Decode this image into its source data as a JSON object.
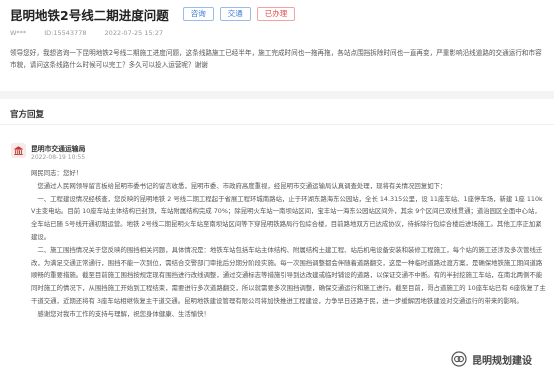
{
  "header": {
    "title": "昆明地铁2号线二期进度问题",
    "tags": [
      "咨询",
      "交通",
      "已办理"
    ],
    "user": "W***",
    "id": "ID:15543778",
    "date": "2022-07-25 15:27"
  },
  "question": "领导您好，我想咨询一下昆明地铁2号线二期施工进度问题，这条线路施工已经半年，施工完成时间也一拖再拖，各站点围挡拆除时间也一直再变，严重影响沿线道路的交通运行和市容市貌，请问这条线路什么时候可以完工？多久可以投入运营呢？谢谢",
  "section_title": "官方回复",
  "reply": {
    "org": "昆明市交通运输局",
    "date": "2022-08-19 10:55",
    "paragraphs": [
      "网民同志：您好！",
      "您通过人民网领导留言板给昆明市委书记的留言收悉，昆明市委、市政府高度重视，经昆明市交通运输局认真调查处理，现将有关情况回复如下：",
      "一、工程建设情况经核查，您反映的昆明地铁 2 号线二期工程起于省展工程环城南路站，止于环湖东路海东公园站，全长 14.315公里，设 11座车站、1座停车场，新建 1座 110kV主变电站。目前 10座车站主体结构已封顶，车站附属结构完成 70%；除昆明火车站一南坝站区间，宝丰站一海东公园站区间外，其余 9个区间已双线贯通；道治园区全面中心站，全车站已随 5号线开通初期运营。地铁 2号线二期昆明火车站至南坝站区间等下穿昆明铁路局行包綜合楼，目前路地双方已达成协议，待拆除行包綜合楼后进场施工。其他工序正加紧建设。",
      "二、施工围挡情况关于您反映的围挡相关问题，具体情况是：地铁车站包括车站主体结构、附属结构土建工程、站后机电设备安装和装修工程施工，每个站的施工还涉及多次管线迁改，为满足交通正常通行，围挡不能一次到位，需结合交警部门审批后分期分阶段实施。每一次围挡调整都会伴随着道路翻交，这是一种临时道路过渡方案，是确保地铁施工期间道路顺畅的重要措施。截至目前施工围挡按规定现有围挡进行改线调整，通过交通标志等措施引导到达改建或临时铺设的道路，以保证交通不中断。有的半封挖施工车站，在南北两侧不能同时施工的情况下，从围挡施工开始到工程结束，需要进行多次道路翻交，所以就需要多次围挡调整，确保交通运行和施工进行。截至目前，哥占道施工的 10座车站已有 6座恢复了主干道交通，近期还将有 3座车站相继恢复主干道交通。昆明地铁建设管理有限公司将加快推进工程建设，力争早日还路于民，进一步缓解因地铁建设对交通运行的带来的影响。",
      "感谢您对我市工作的支持与理解，祝您身体健康、生活愉快！"
    ]
  },
  "watermark": {
    "text": "昆明规划建设",
    "icon": "wechat-public-account-icon"
  },
  "colors": {
    "tag_blue": "#3a7bd5",
    "tag_red": "#e64a4a",
    "avatar_red": "#c0392b"
  }
}
